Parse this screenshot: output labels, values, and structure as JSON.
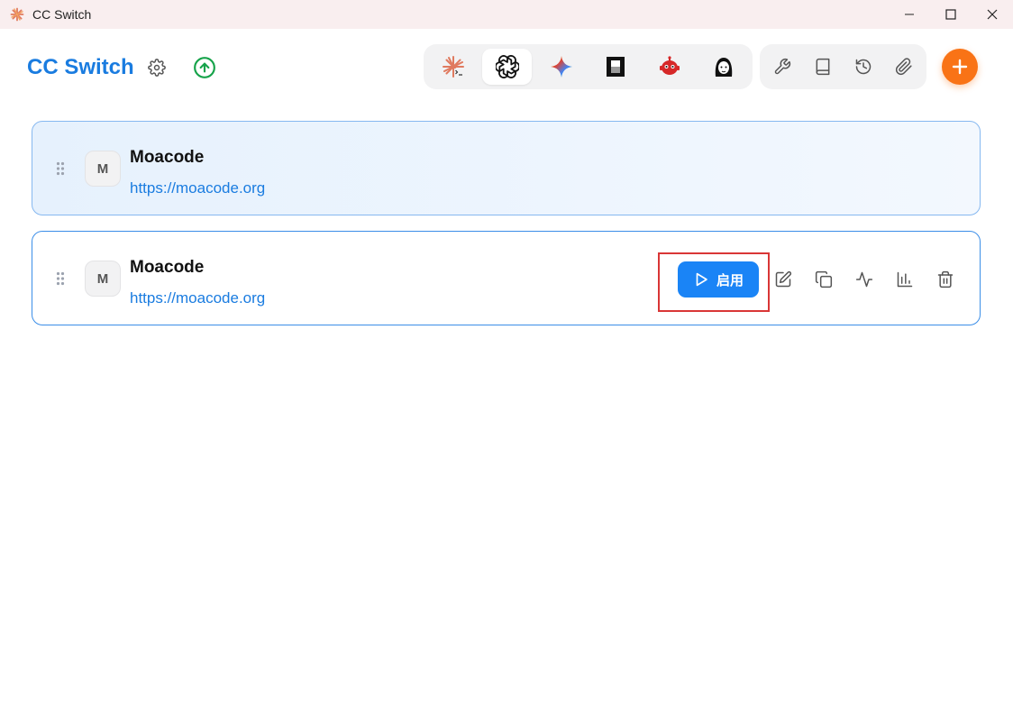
{
  "window": {
    "title": "CC Switch",
    "icons": [
      "claude-logo-icon",
      "minimize-icon",
      "maximize-icon",
      "close-icon"
    ]
  },
  "header": {
    "brand": "CC Switch",
    "icons": [
      "gear-icon",
      "arrow-up-circle-icon"
    ],
    "app_tabs": [
      "claude-code-icon",
      "openai-icon",
      "gemini-icon",
      "opencode-icon",
      "red-robot-icon",
      "avatar-face-icon"
    ],
    "active_tab": "openai-icon",
    "tools": [
      "wrench-icon",
      "book-icon",
      "history-icon",
      "paperclip-icon"
    ],
    "add_icon": "plus-icon"
  },
  "providers": [
    {
      "avatar": "M",
      "name": "Moacode",
      "url": "https://moacode.org",
      "selected": true
    },
    {
      "avatar": "M",
      "name": "Moacode",
      "url": "https://moacode.org",
      "selected": false,
      "enable_label": "启用",
      "actions": [
        "edit-icon",
        "copy-icon",
        "activity-icon",
        "bar-chart-icon",
        "trash-icon"
      ]
    }
  ],
  "colors": {
    "brand": "#1a7ce0",
    "primary_button": "#1a84f6",
    "add_button": "#f97316",
    "highlight": "#d93636",
    "upload_icon": "#16a34a"
  }
}
